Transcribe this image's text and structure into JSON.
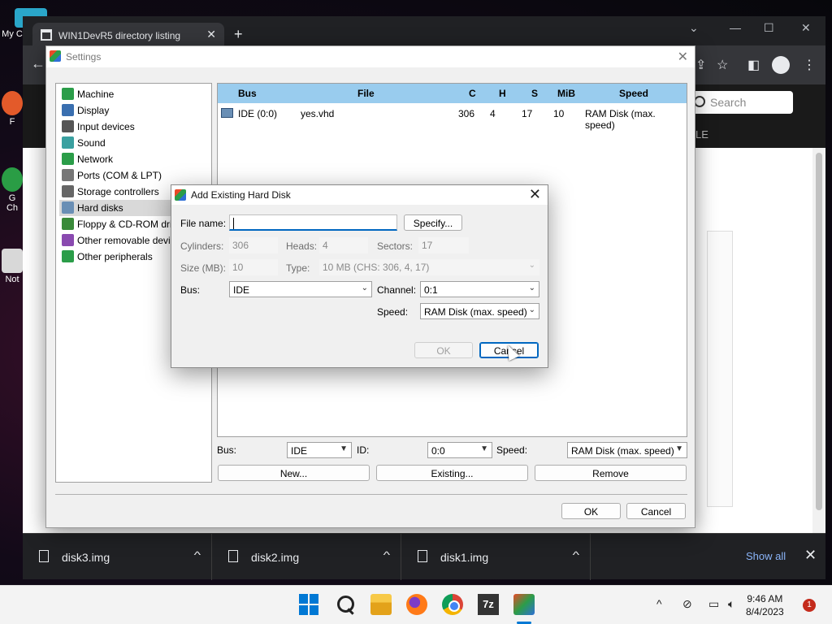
{
  "desktop": {
    "icons": [
      {
        "label": "My C"
      },
      {
        "label": "F"
      },
      {
        "label": "G\nCh"
      },
      {
        "label": "Not"
      }
    ]
  },
  "browser": {
    "tab_title": "WIN1DevR5 directory listing",
    "search_placeholder": "Search",
    "nav_text": "LE"
  },
  "settings": {
    "title": "Settings",
    "tree": [
      {
        "label": "Machine",
        "icon": "machine-icon",
        "color": "#2b9d49"
      },
      {
        "label": "Display",
        "icon": "display-icon",
        "color": "#3a6fb0"
      },
      {
        "label": "Input devices",
        "icon": "input-devices-icon",
        "color": "#555555"
      },
      {
        "label": "Sound",
        "icon": "sound-icon",
        "color": "#3aa0a0"
      },
      {
        "label": "Network",
        "icon": "network-icon",
        "color": "#2b9d49"
      },
      {
        "label": "Ports (COM & LPT)",
        "icon": "ports-icon",
        "color": "#777777"
      },
      {
        "label": "Storage controllers",
        "icon": "storage-controllers-icon",
        "color": "#666666"
      },
      {
        "label": "Hard disks",
        "icon": "hard-disk-icon",
        "color": "#6a8fb5"
      },
      {
        "label": "Floppy & CD-ROM drives",
        "icon": "floppy-icon",
        "color": "#3a8a3a"
      },
      {
        "label": "Other removable devices",
        "icon": "removable-device-icon",
        "color": "#8a4ab0"
      },
      {
        "label": "Other peripherals",
        "icon": "peripherals-icon",
        "color": "#2b9d49"
      }
    ],
    "selected_tree_index": 7,
    "disk_table": {
      "headers": {
        "bus": "Bus",
        "file": "File",
        "c": "C",
        "h": "H",
        "s": "S",
        "mib": "MiB",
        "speed": "Speed"
      },
      "rows": [
        {
          "bus": "IDE (0:0)",
          "file": "yes.vhd",
          "c": "306",
          "h": "4",
          "s": "17",
          "mib": "10",
          "speed": "RAM Disk (max. speed)"
        }
      ]
    },
    "bus_label": "Bus:",
    "bus_value": "IDE",
    "id_label": "ID:",
    "id_value": "0:0",
    "speed_label": "Speed:",
    "speed_value": "RAM Disk (max. speed)",
    "new_button": "New...",
    "existing_button": "Existing...",
    "remove_button": "Remove",
    "ok_button": "OK",
    "cancel_button": "Cancel"
  },
  "dialog": {
    "title": "Add Existing Hard Disk",
    "file_name_label": "File name:",
    "file_name_value": "",
    "specify_button": "Specify...",
    "cylinders_label": "Cylinders:",
    "cylinders_value": "306",
    "heads_label": "Heads:",
    "heads_value": "4",
    "sectors_label": "Sectors:",
    "sectors_value": "17",
    "size_label": "Size (MB):",
    "size_value": "10",
    "type_label": "Type:",
    "type_value": "10 MB (CHS: 306, 4, 17)",
    "bus_label": "Bus:",
    "bus_value": "IDE",
    "channel_label": "Channel:",
    "channel_value": "0:1",
    "speed_label": "Speed:",
    "speed_value": "RAM Disk (max. speed)",
    "ok_button": "OK",
    "cancel_button": "Cancel"
  },
  "downloads": {
    "items": [
      {
        "name": "disk3.img"
      },
      {
        "name": "disk2.img"
      },
      {
        "name": "disk1.img"
      }
    ],
    "show_all": "Show all"
  },
  "taskbar": {
    "seven_zip_label": "7z",
    "time": "9:46 AM",
    "date": "8/4/2023",
    "notification_count": "1"
  }
}
